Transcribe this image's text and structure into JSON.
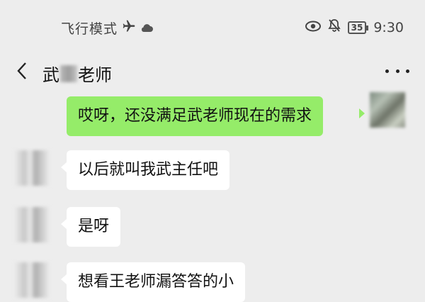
{
  "status_bar": {
    "left_text": "飞行模式",
    "time": "9:30",
    "battery": "35",
    "icons": [
      "airplane-icon",
      "cloud-icon",
      "eye-icon",
      "bell-muted-icon",
      "battery-icon"
    ]
  },
  "header": {
    "title_prefix": "武",
    "title_suffix": "老师",
    "icons": [
      "back-chevron-icon",
      "more-dots-icon"
    ]
  },
  "messages": [
    {
      "side": "right",
      "text": "哎呀，还没满足武老师现在的需求"
    },
    {
      "side": "left",
      "text": "以后就叫我武主任吧"
    },
    {
      "side": "left",
      "text": "是呀"
    },
    {
      "side": "left",
      "text": "想看王老师漏答答的小"
    }
  ],
  "colors": {
    "background": "#ededed",
    "outgoing_bubble": "#95ec69",
    "incoming_bubble": "#ffffff"
  }
}
